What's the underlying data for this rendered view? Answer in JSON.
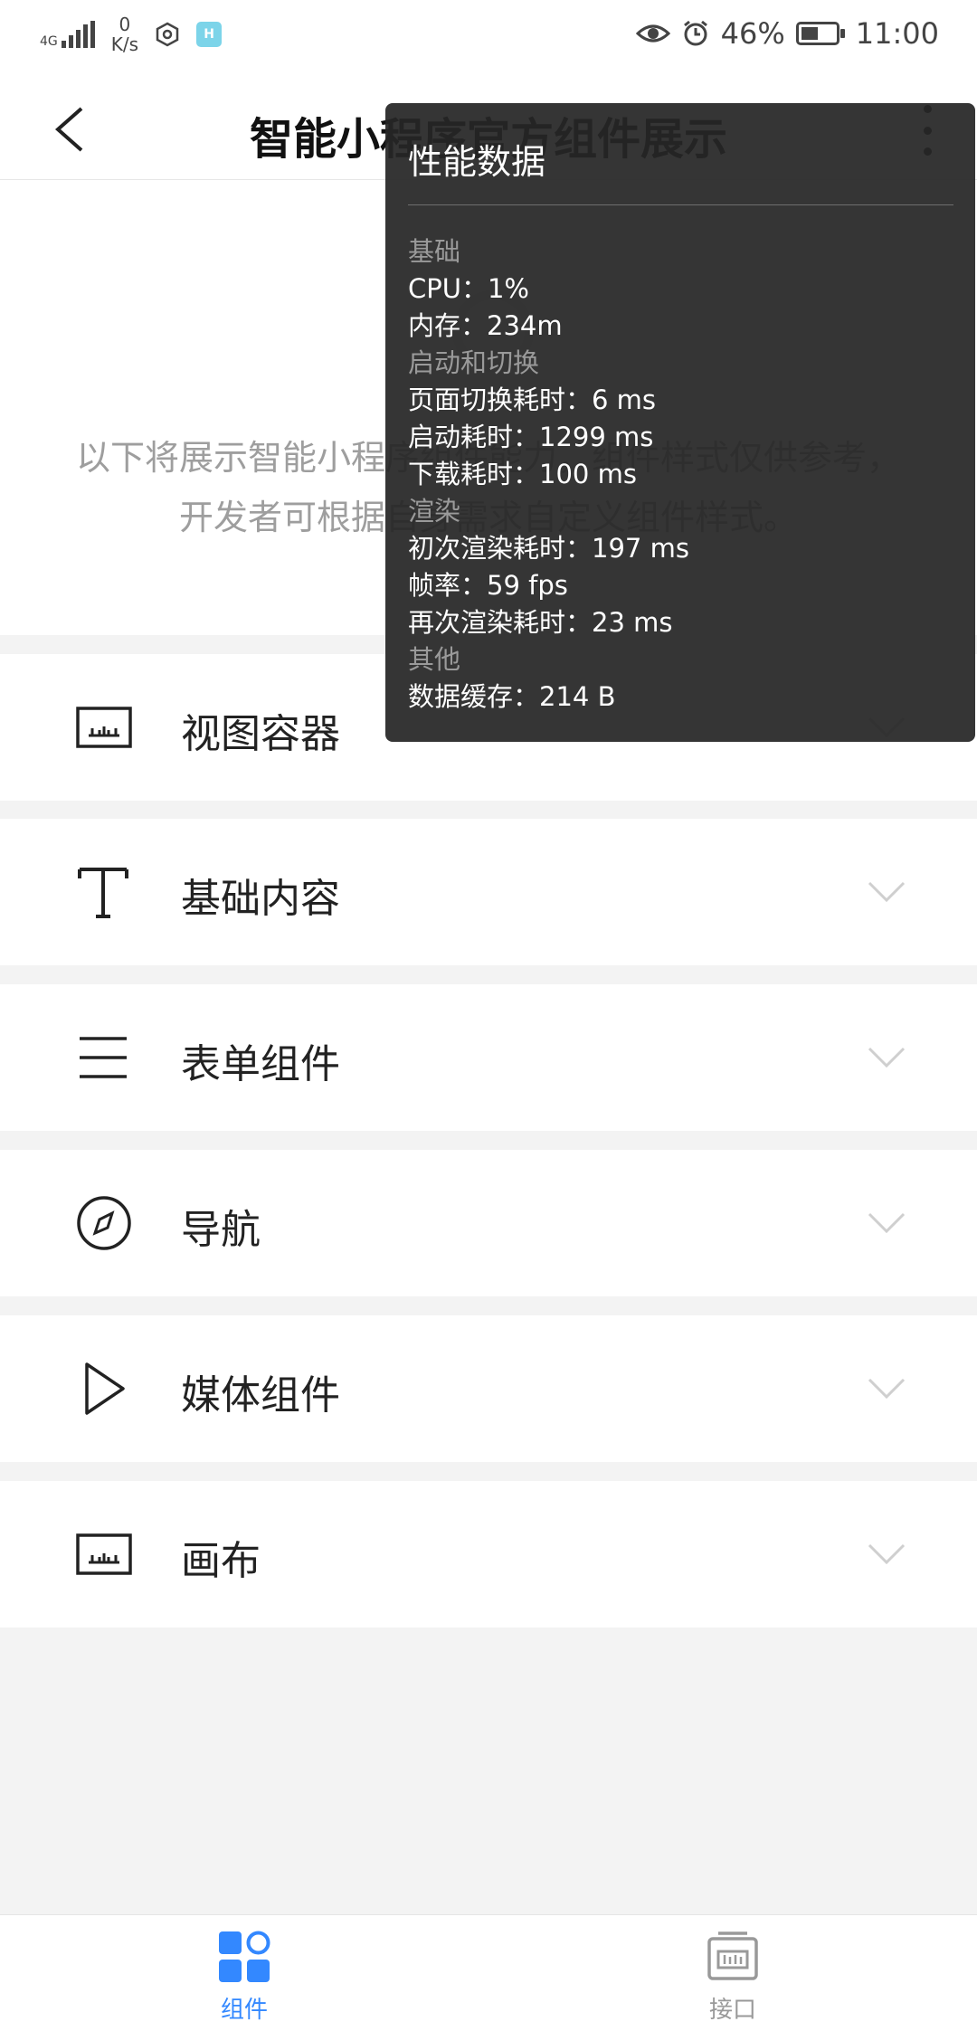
{
  "status_bar": {
    "network": "4G",
    "speed_value": "0",
    "speed_unit": "K/s",
    "app_badge": "H",
    "battery": "46%",
    "time": "11:00"
  },
  "header": {
    "title": "智能小程序官方组件展示"
  },
  "intro": {
    "text": "以下将展示智能小程序组件能力，组件样式仅供参考，开发者可根据自身需求自定义组件样式。"
  },
  "sections": [
    {
      "label": "视图容器",
      "icon": "view-container-icon"
    },
    {
      "label": "基础内容",
      "icon": "text-t-icon"
    },
    {
      "label": "表单组件",
      "icon": "list-lines-icon"
    },
    {
      "label": "导航",
      "icon": "compass-icon"
    },
    {
      "label": "媒体组件",
      "icon": "play-icon"
    },
    {
      "label": "画布",
      "icon": "canvas-icon"
    }
  ],
  "perf": {
    "title": "性能数据",
    "basic_header": "基础",
    "cpu": "CPU：1%",
    "memory": "内存：234m",
    "launch_header": "启动和切换",
    "page_switch": "页面切换耗时：6 ms",
    "launch_time": "启动耗时：1299 ms",
    "download_time": "下载耗时：100 ms",
    "render_header": "渲染",
    "first_render": "初次渲染耗时：197 ms",
    "fps": "帧率：59 fps",
    "rerender": "再次渲染耗时：23 ms",
    "other_header": "其他",
    "data_cache": "数据缓存：214 B"
  },
  "tabs": [
    {
      "label": "组件",
      "active": true
    },
    {
      "label": "接口",
      "active": false
    }
  ],
  "colors": {
    "accent": "#3388ff",
    "overlay": "#262626"
  }
}
